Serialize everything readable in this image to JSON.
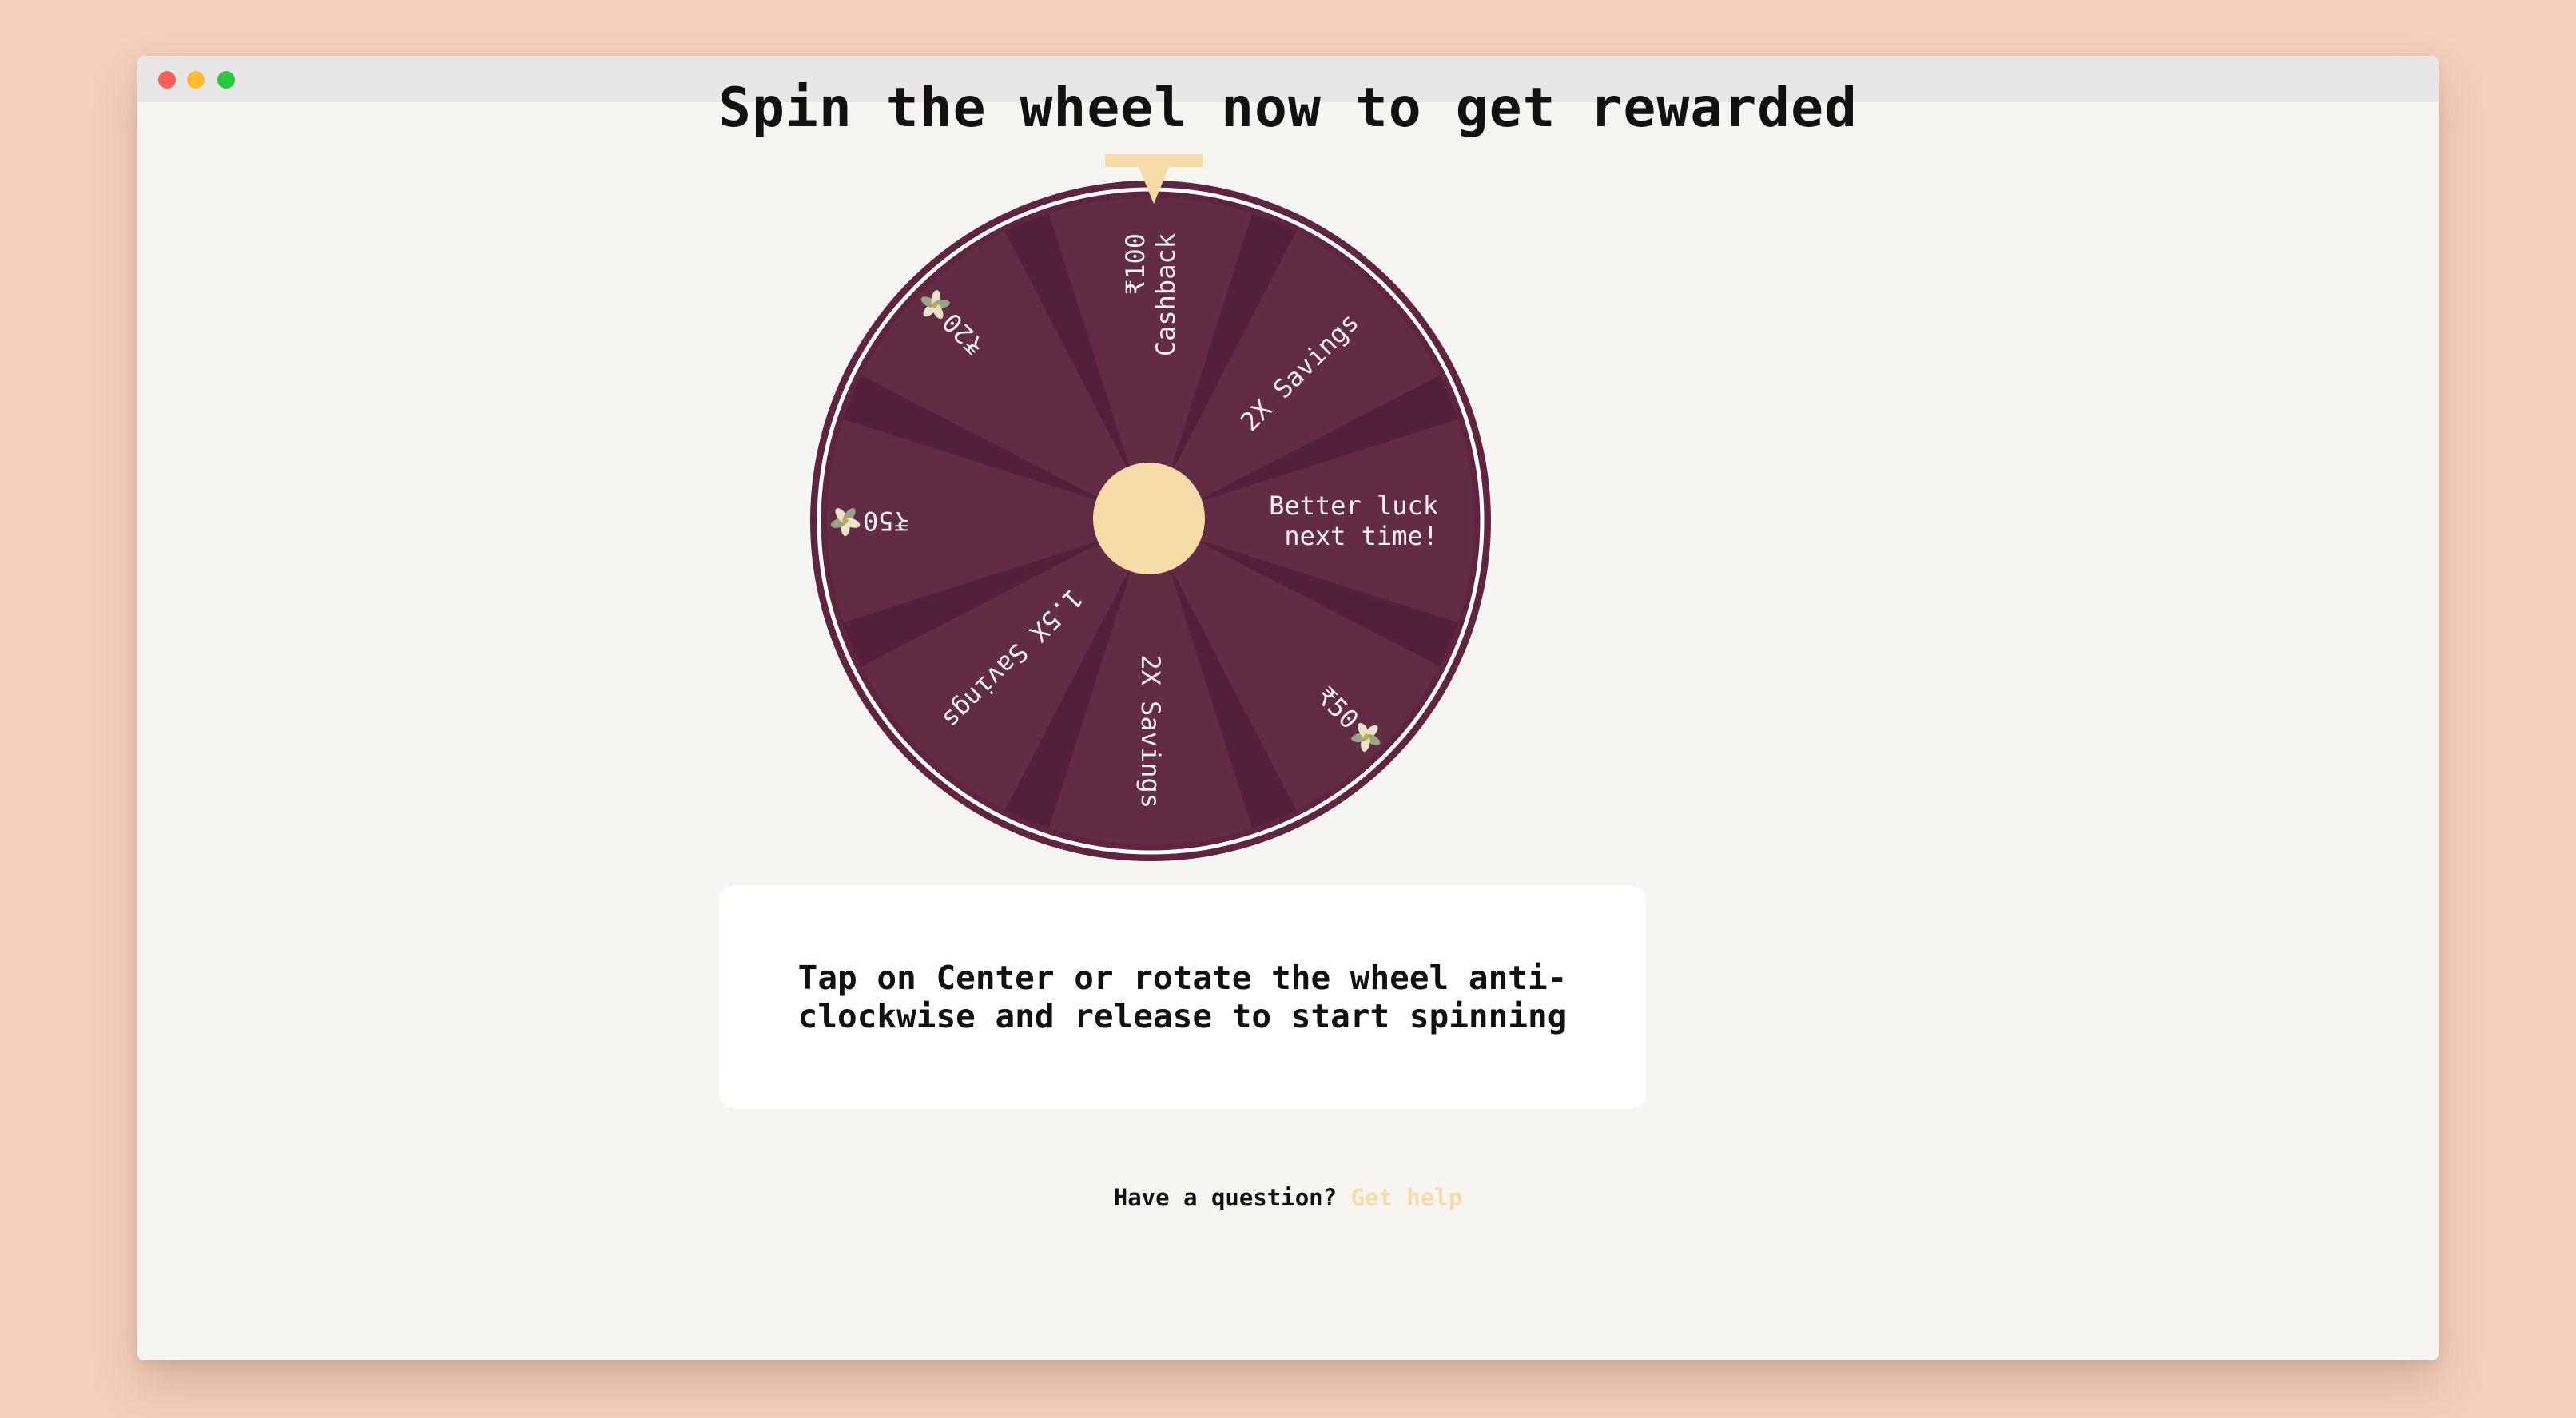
{
  "window": {
    "controls": [
      {
        "name": "close",
        "color": "#fe5f57"
      },
      {
        "name": "minimize",
        "color": "#febc2e"
      },
      {
        "name": "maximize",
        "color": "#28c840"
      }
    ]
  },
  "page": {
    "title": "Spin the wheel now to get rewarded"
  },
  "wheel": {
    "colors": {
      "rim": "#5e2440",
      "rim_line": "#ffffff",
      "segment": "#622d44",
      "divider": "#52203a",
      "center": "#f8dca8",
      "pointer": "#f8dca8",
      "label": "#f5eef0"
    },
    "segments": [
      {
        "lines": [
          "₹100",
          "Cashback"
        ],
        "icon": null
      },
      {
        "lines": [
          "2X Savings"
        ],
        "icon": null
      },
      {
        "lines": [
          "Better luck",
          "next time!"
        ],
        "icon": null
      },
      {
        "lines": [
          "₹50"
        ],
        "icon": "lotus-icon"
      },
      {
        "lines": [
          "2X Savings"
        ],
        "icon": null
      },
      {
        "lines": [
          "1.5X Savings"
        ],
        "icon": null
      },
      {
        "lines": [
          "₹50"
        ],
        "icon": "lotus-icon"
      },
      {
        "lines": [
          "₹20"
        ],
        "icon": "lotus-icon"
      }
    ]
  },
  "instruction": {
    "text": "Tap on Center or rotate the wheel anti-clockwise and release to start spinning"
  },
  "footer": {
    "question": "Have a question?",
    "help_link": "Get help",
    "help_link_color": "#f8dca8"
  }
}
